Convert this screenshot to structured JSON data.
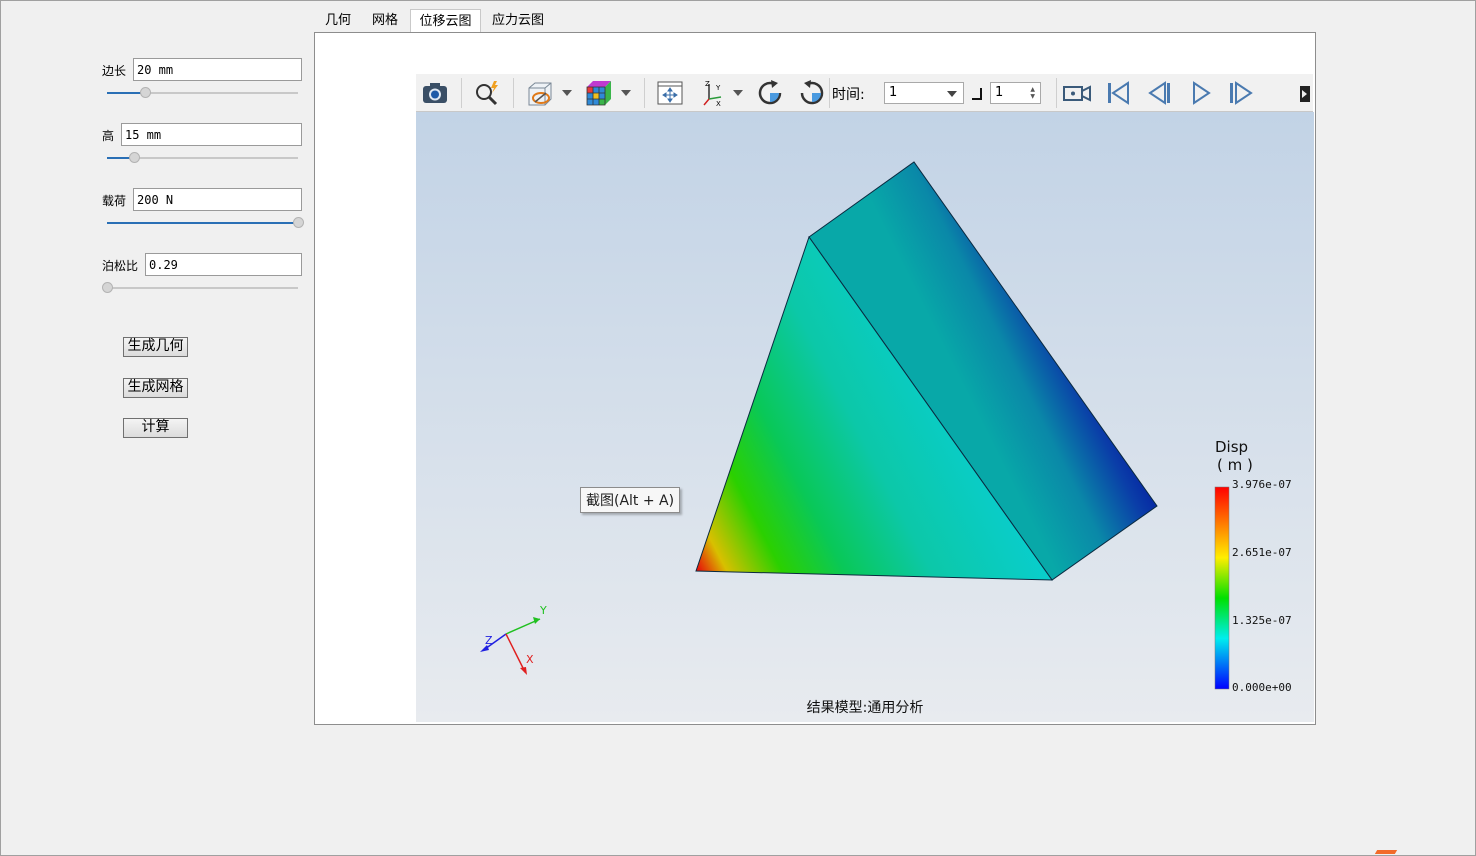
{
  "params": {
    "edge": {
      "label": "边长",
      "value": "20 mm",
      "slider": 0.2
    },
    "height": {
      "label": "高",
      "value": "15 mm",
      "slider": 0.14
    },
    "load": {
      "label": "载荷",
      "value": "200 N",
      "slider": 1.0
    },
    "poisson": {
      "label": "泊松比",
      "value": "0.29",
      "slider": 0.0
    }
  },
  "buttons": {
    "gen_geometry": "生成几何",
    "gen_mesh": "生成网格",
    "compute": "计算"
  },
  "tabs": [
    {
      "label": "几何"
    },
    {
      "label": "网格"
    },
    {
      "label": "位移云图",
      "active": true
    },
    {
      "label": "应力云图"
    }
  ],
  "toolbar": {
    "time_label": "时间:",
    "time_value": "1",
    "step_value": "1"
  },
  "tooltip": "截图(Alt + A)",
  "legend": {
    "title": "Disp",
    "unit": "( m )",
    "values": [
      "3.976e-07",
      "2.651e-07",
      "1.325e-07",
      "0.000e+00"
    ]
  },
  "triad": {
    "x": "X",
    "y": "Y",
    "z": "Z"
  },
  "model_caption": "结果模型:通用分析",
  "colors": {
    "accent": "#2a6fb5",
    "legend_top": "#ff0000",
    "legend_bottom": "#0000ff"
  }
}
